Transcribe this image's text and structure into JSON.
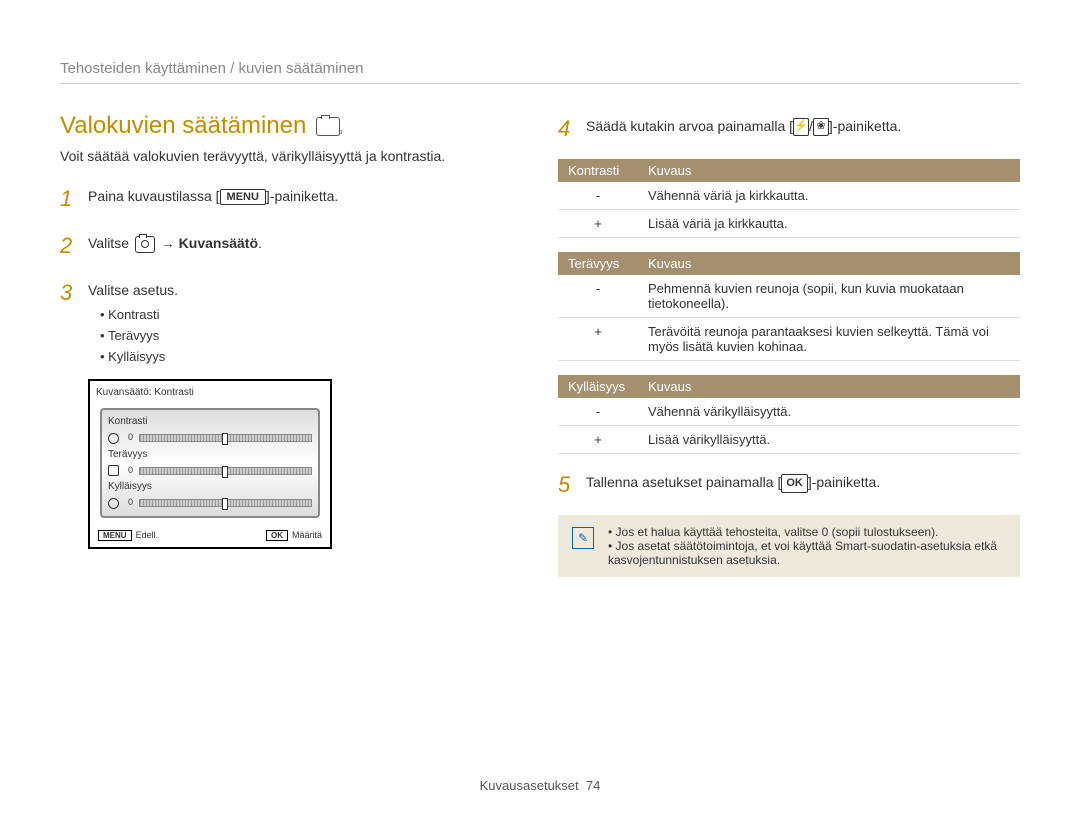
{
  "section_header": "Tehosteiden käyttäminen / kuvien säätäminen",
  "title": "Valokuvien säätäminen",
  "intro": "Voit säätää valokuvien terävyyttä, värikylläisyyttä ja kontrastia.",
  "steps": {
    "s1": {
      "num": "1",
      "pre": "Paina kuvaustilassa [",
      "btn": "MENU",
      "post": "]-painiketta."
    },
    "s2": {
      "num": "2",
      "pre": "Valitse ",
      "arrow": " → ",
      "bold": "Kuvansäätö",
      "post": "."
    },
    "s3": {
      "num": "3",
      "text": "Valitse asetus.",
      "items": [
        "Kontrasti",
        "Terävyys",
        "Kylläisyys"
      ]
    },
    "s4": {
      "num": "4",
      "pre": "Säädä kutakin arvoa painamalla [",
      "sep": "/",
      "post": "]-painiketta."
    },
    "s5": {
      "num": "5",
      "pre": "Tallenna asetukset painamalla [",
      "btn": "OK",
      "post": "]-painiketta."
    }
  },
  "device": {
    "title": "Kuvansäätö: Kontrasti",
    "rows": [
      "Kontrasti",
      "Terävyys",
      "Kylläisyys"
    ],
    "zero": "0",
    "back_btn": "MENU",
    "back": "Edell.",
    "ok_btn": "OK",
    "ok": "Määritä"
  },
  "tables": {
    "t1": {
      "h1": "Kontrasti",
      "h2": "Kuvaus",
      "r1s": "-",
      "r1": "Vähennä väriä ja kirkkautta.",
      "r2s": "+",
      "r2": "Lisää väriä ja kirkkautta."
    },
    "t2": {
      "h1": "Terävyys",
      "h2": "Kuvaus",
      "r1s": "-",
      "r1": "Pehmennä kuvien reunoja (sopii, kun kuvia muokataan tietokoneella).",
      "r2s": "+",
      "r2": "Terävöitä reunoja parantaaksesi kuvien selkeyttä. Tämä voi myös lisätä kuvien kohinaa."
    },
    "t3": {
      "h1": "Kylläisyys",
      "h2": "Kuvaus",
      "r1s": "-",
      "r1": "Vähennä värikylläisyyttä.",
      "r2s": "+",
      "r2": "Lisää värikylläisyyttä."
    }
  },
  "notes": {
    "n1": "Jos et halua käyttää tehosteita, valitse 0 (sopii tulostukseen).",
    "n2": "Jos asetat säätötoimintoja, et voi käyttää Smart-suodatin-asetuksia etkä kasvojentunnistuksen asetuksia."
  },
  "footer": {
    "label": "Kuvausasetukset",
    "page": "74"
  }
}
